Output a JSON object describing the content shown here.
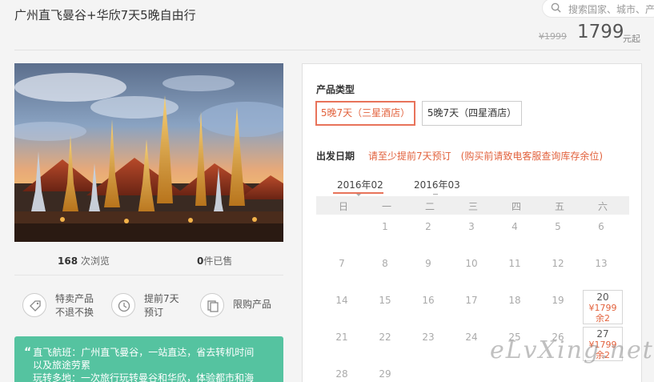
{
  "page": {
    "title": "广州直飞曼谷+华欣7天5晚自由行"
  },
  "search": {
    "placeholder": "搜索国家、城市、产"
  },
  "price": {
    "original": "¥1999",
    "current": "1799",
    "suffix": "元起"
  },
  "stats": {
    "views_count": "168",
    "views_label": "次浏览",
    "sold_count": "0",
    "sold_label": "件已售"
  },
  "features": [
    {
      "line1": "特卖产品",
      "line2": "不退不换",
      "icon": "tag-icon"
    },
    {
      "line1": "提前7天",
      "line2": "预订",
      "icon": "clock-icon"
    },
    {
      "line1": "限购产品",
      "line2": "",
      "icon": "copy-icon"
    }
  ],
  "notice": {
    "line1": "直飞航班：广州直飞曼谷，一站直达，省去转机时间",
    "line2": "以及旅途劳累",
    "line3": "玩转多地：一次旅行玩转曼谷和华欣，体验都市和海"
  },
  "booking": {
    "product_type_label": "产品类型",
    "options": [
      "5晚7天（三星酒店）",
      "5晚7天（四星酒店）"
    ],
    "selected_option": 0,
    "date_label": "出发日期",
    "date_hint": "请至少提前7天预订　(购买前请致电客服查询库存余位)",
    "months": [
      "2016年02",
      "2016年03"
    ],
    "active_month": 0,
    "weekdays": [
      "日",
      "一",
      "二",
      "三",
      "四",
      "五",
      "六"
    ]
  },
  "calendar": {
    "weeks": [
      [
        "",
        "1",
        "2",
        "3",
        "4",
        "5",
        "6"
      ],
      [
        "7",
        "8",
        "9",
        "10",
        "11",
        "12",
        "13"
      ],
      [
        "14",
        "15",
        "16",
        "17",
        "18",
        "19",
        "20"
      ],
      [
        "21",
        "22",
        "23",
        "24",
        "25",
        "26",
        "27"
      ],
      [
        "28",
        "29",
        "",
        "",
        "",
        "",
        ""
      ]
    ],
    "available": {
      "20": {
        "price": "¥1799",
        "stock": "余2"
      },
      "27": {
        "price": "¥1799",
        "stock": "余2"
      }
    }
  },
  "watermark": "eLvXing.net",
  "colors": {
    "accent": "#e2623d",
    "notice_bg": "#55c3a0"
  }
}
